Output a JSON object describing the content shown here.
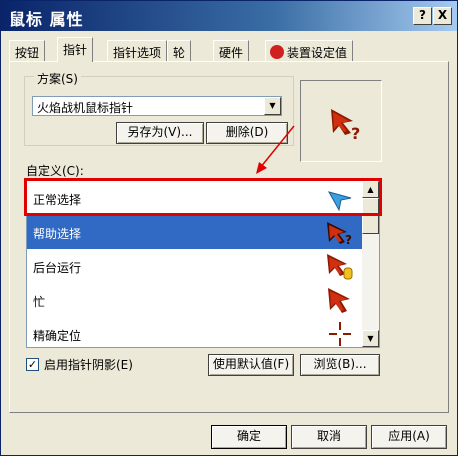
{
  "window": {
    "title": "鼠标 属性",
    "help_label": "?",
    "close_label": "X"
  },
  "tabs": [
    {
      "label": "按钮",
      "active": false
    },
    {
      "label": "指针",
      "active": true
    },
    {
      "label": "指针选项",
      "active": false
    },
    {
      "label": "轮",
      "active": false
    },
    {
      "label": "硬件",
      "active": false
    },
    {
      "label": "装置设定值",
      "active": false
    }
  ],
  "scheme": {
    "label": "方案(S)",
    "value": "火焰战机鼠标指针",
    "save_as_label": "另存为(V)...",
    "delete_label": "删除(D)"
  },
  "customize": {
    "label": "自定义(C):",
    "items": [
      {
        "label": "正常选择",
        "icon": "arrow-cursor-icon",
        "selected": false
      },
      {
        "label": "帮助选择",
        "icon": "flame-help-cursor-icon",
        "selected": true
      },
      {
        "label": "后台运行",
        "icon": "flame-busy-cursor-icon",
        "selected": false
      },
      {
        "label": "忙",
        "icon": "flame-cursor-icon",
        "selected": false
      },
      {
        "label": "精确定位",
        "icon": "crosshair-icon",
        "selected": false
      }
    ]
  },
  "shadow": {
    "label": "启用指针阴影(E)",
    "checked": true,
    "check_mark": "✓"
  },
  "buttons": {
    "use_default": "使用默认值(F)",
    "browse": "浏览(B)...",
    "ok": "确定",
    "cancel": "取消",
    "apply": "应用(A)"
  },
  "colors": {
    "title_gradient_start": "#0a246a",
    "selection": "#316ac5",
    "highlight_box": "#e00000",
    "arrow": "#e00000",
    "cursor_dark": "#8b1a00",
    "cursor_flame": "#d03010"
  }
}
